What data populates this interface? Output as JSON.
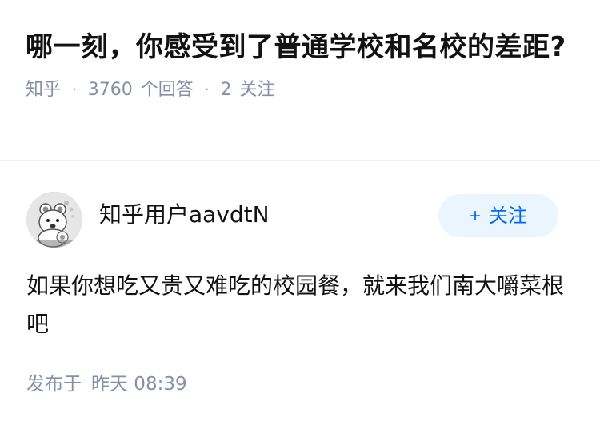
{
  "question": {
    "title": "哪一刻，你感受到了普通学校和名校的差距?",
    "source": "知乎",
    "answer_count": "3760",
    "answer_count_label": "个回答",
    "follow_count": "2",
    "follow_label": "关注"
  },
  "answer": {
    "author_name": "知乎用户aavdtN",
    "follow_button_label": "关注",
    "follow_button_icon": "plus-icon",
    "content": "如果你想吃又贵又难吃的校园餐，就来我们南大嚼菜根吧",
    "time_label": "发布于",
    "time_value": "昨天 08:39"
  },
  "colors": {
    "title": "#121212",
    "meta": "#8590a6",
    "follow_bg": "#ebf5ff",
    "follow_text": "#0066ff"
  }
}
